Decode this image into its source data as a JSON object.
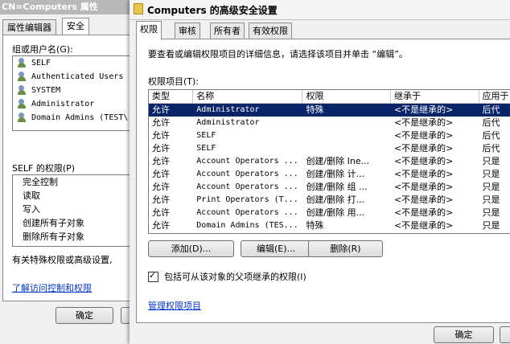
{
  "back_dialog": {
    "title": "CN=Computers 属性",
    "tabs": [
      "属性编辑器",
      "安全"
    ],
    "users_label": "组或用户名(G):",
    "users": [
      "SELF",
      "Authenticated Users",
      "SYSTEM",
      "Administrator",
      "Domain Admins (TEST\\"
    ],
    "perm_label": "SELF 的权限(P)",
    "perms": [
      "完全控制",
      "读取",
      "写入",
      "创建所有子对象",
      "删除所有子对象"
    ],
    "note": "有关特殊权限或高级设置,",
    "link": "了解访问控制和权限",
    "ok": "确定"
  },
  "dialog": {
    "title": "Computers 的高级安全设置",
    "tabs": [
      "权限",
      "审核",
      "所有者",
      "有效权限"
    ],
    "instructions": "要查看或编辑权限项目的详细信息，请选择该项目并单击 “编辑”。",
    "entries_label": "权限项目(T):",
    "columns": [
      "类型",
      "名称",
      "权限",
      "继承于",
      "应用于"
    ],
    "rows": [
      [
        "允许",
        "Administrator",
        "特殊",
        "<不是继承的>",
        "后代"
      ],
      [
        "允许",
        "Administrator",
        "",
        "<不是继承的>",
        "后代"
      ],
      [
        "允许",
        "SELF",
        "",
        "<不是继承的>",
        "后代"
      ],
      [
        "允许",
        "SELF",
        "",
        "<不是继承的>",
        "后代"
      ],
      [
        "允许",
        "Account Operators ...",
        "创建/删除 Ine...",
        "<不是继承的>",
        "只是"
      ],
      [
        "允许",
        "Account Operators ...",
        "创建/删除 计...",
        "<不是继承的>",
        "只是"
      ],
      [
        "允许",
        "Account Operators ...",
        "创建/删除 组 ...",
        "<不是继承的>",
        "只是"
      ],
      [
        "允许",
        "Print Operators (T...",
        "创建/删除 打...",
        "<不是继承的>",
        "只是"
      ],
      [
        "允许",
        "Account Operators ...",
        "创建/删除 用...",
        "<不是继承的>",
        "只是"
      ],
      [
        "允许",
        "Domain Admins (TES...",
        "特殊",
        "<不是继承的>",
        "只是"
      ]
    ],
    "add": "添加(D)...",
    "edit": "编辑(E)...",
    "delete": "删除(R)",
    "inherit_label": "包括可从该对象的父项继承的权限(I)",
    "manage_link": "管理权限项目",
    "ok": "确定"
  }
}
